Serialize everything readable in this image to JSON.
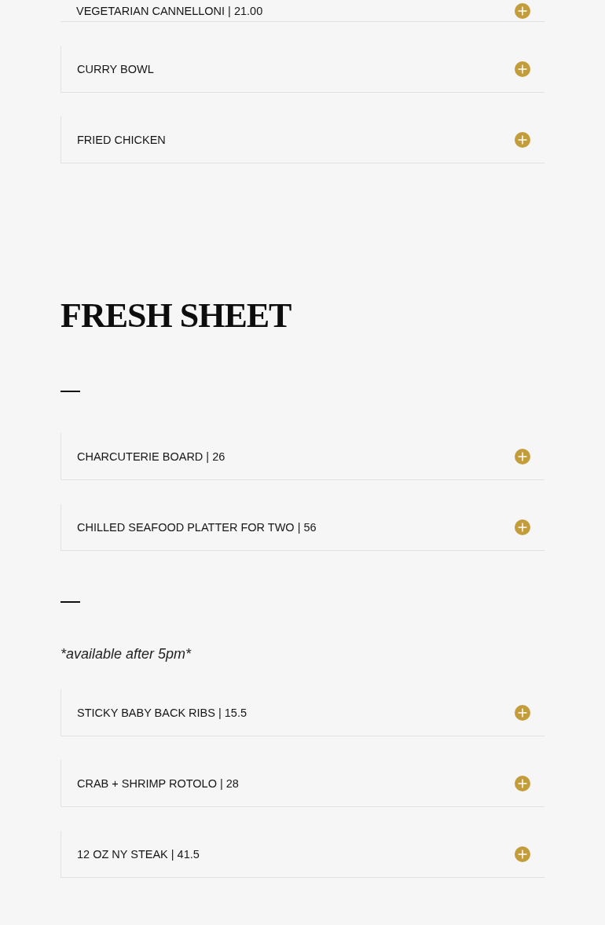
{
  "menu_list": {
    "items": [
      {
        "label": "VEGETARIAN CANNELLONI | 21.00",
        "expanded": false
      },
      {
        "label": "CURRY BOWL",
        "expanded": false
      },
      {
        "label": "FRIED CHICKEN",
        "expanded": false
      }
    ]
  },
  "fresh_sheet": {
    "title": "FRESH SHEET",
    "groups": [
      {
        "items": [
          {
            "label": "CHARCUTERIE BOARD | 26",
            "expanded": false
          },
          {
            "label": "CHILLED SEAFOOD PLATTER FOR TWO | 56",
            "expanded": false
          }
        ]
      },
      {
        "note": "*available after 5pm*",
        "items": [
          {
            "label": "STICKY BABY BACK RIBS | 15.5",
            "expanded": false
          },
          {
            "label": "CRAB + SHRIMP ROTOLO | 28",
            "expanded": false
          },
          {
            "label": "12 OZ NY STEAK | 41.5",
            "expanded": false
          }
        ]
      }
    ]
  }
}
